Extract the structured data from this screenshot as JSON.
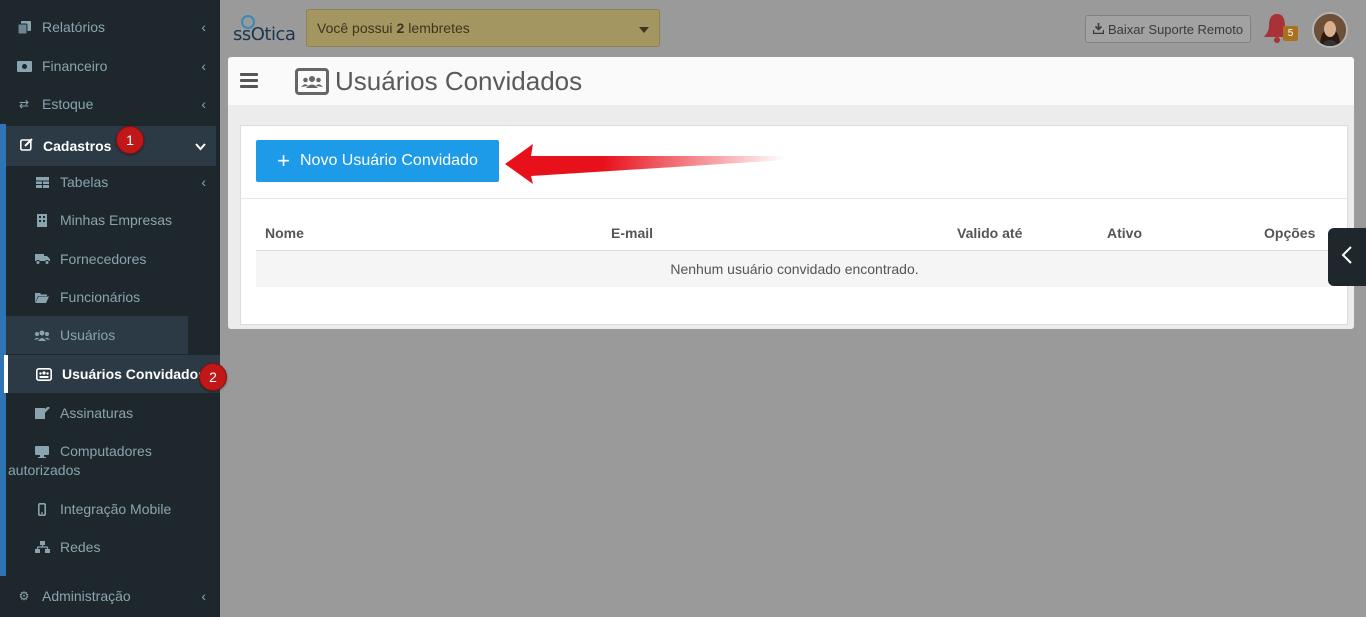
{
  "sidebar": {
    "relatorios": "Relatórios",
    "financeiro": "Financeiro",
    "estoque": "Estoque",
    "cadastros": "Cadastros",
    "cadastros_badge": "1",
    "sub": {
      "tabelas": "Tabelas",
      "minhas_empresas": "Minhas Empresas",
      "fornecedores": "Fornecedores",
      "funcionarios": "Funcionários",
      "usuarios": "Usuários",
      "usuarios_convidados": "Usuários Convidados",
      "usuarios_convidados_badge": "2",
      "assinaturas": "Assinaturas",
      "computadores_l1": "Computadores",
      "computadores_l2": "autorizados",
      "integracao_mobile": "Integração Mobile",
      "redes": "Redes"
    },
    "administracao": "Administração"
  },
  "header": {
    "logo_text": "ssOtica",
    "reminder_prefix": "Você possui",
    "reminder_count": "2",
    "reminder_suffix": "lembretes",
    "support_button": "Baixar Suporte Remoto",
    "notifications_count": "5"
  },
  "page": {
    "title": "Usuários Convidados",
    "new_button": "Novo Usuário Convidado",
    "columns": [
      "Nome",
      "E-mail",
      "Valido até",
      "Ativo",
      "Opções"
    ],
    "empty_message": "Nenhum usuário convidado encontrado."
  },
  "colors": {
    "sidebar_bg": "#1e282c",
    "primary_button": "#1e9be8",
    "badge_red": "#c01818",
    "arrow_red": "#e8101a"
  }
}
